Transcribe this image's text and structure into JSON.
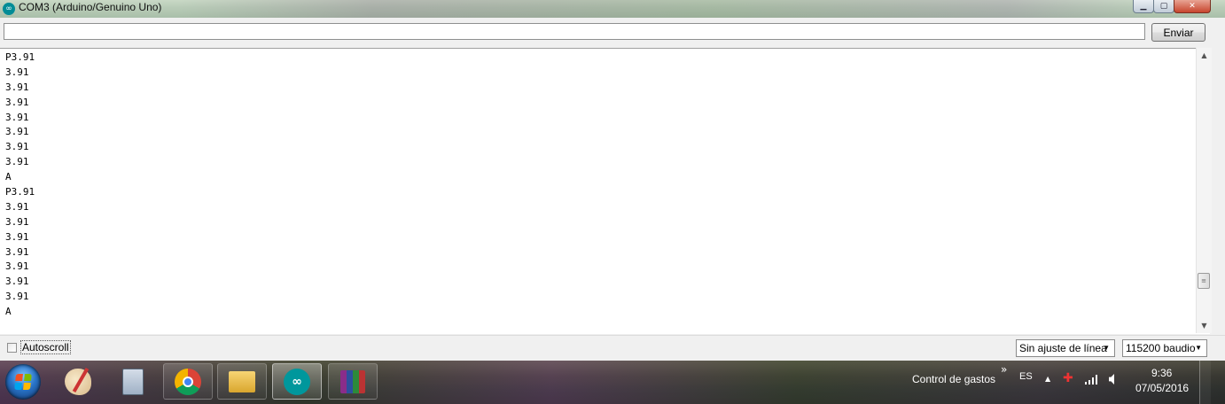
{
  "window": {
    "title": "COM3 (Arduino/Genuino Uno)",
    "icon": "arduino-icon",
    "controls": {
      "minimize": "▁",
      "maximize": "▢",
      "close": "✕"
    }
  },
  "send": {
    "input_value": "",
    "button_label": "Enviar"
  },
  "output": {
    "lines": [
      "P3.91",
      "3.91",
      "3.91",
      "3.91",
      "3.91",
      "3.91",
      "3.91",
      "3.91",
      "A",
      "P3.91",
      "3.91",
      "3.91",
      "3.91",
      "3.91",
      "3.91",
      "3.91",
      "3.91",
      "A"
    ]
  },
  "scrollbar": {
    "up_arrow": "▲",
    "down_arrow": "▼",
    "thumb_grip": "≡"
  },
  "footer": {
    "autoscroll_label": "Autoscroll",
    "autoscroll_checked": false,
    "line_ending": "Sin ajuste de línea",
    "baud_rate": "115200 baudio",
    "dropdown_arrow": "▼"
  },
  "taskbar": {
    "apps": [
      {
        "name": "paint",
        "icon": "paint-icon"
      },
      {
        "name": "calculator",
        "icon": "calculator-icon"
      },
      {
        "name": "chrome",
        "icon": "chrome-icon"
      },
      {
        "name": "explorer",
        "icon": "folder-icon"
      },
      {
        "name": "arduino",
        "icon": "arduino-icon",
        "glyph": "∞"
      },
      {
        "name": "winrar",
        "icon": "winrar-icon"
      }
    ],
    "toolbar_label": "Control de gastos",
    "toolbar_chevron": "»",
    "language": "ES",
    "tray_expand": "▲",
    "time": "9:36",
    "date": "07/05/2016"
  }
}
